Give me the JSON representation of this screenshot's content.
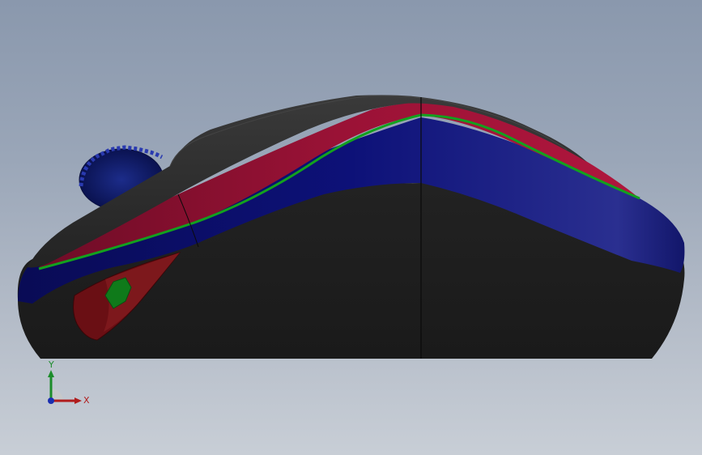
{
  "viewport": {
    "background_top": "#8a98ad",
    "background_bottom": "#c8ced6"
  },
  "model": {
    "colors": {
      "body_shell": "#1f1f1f",
      "top_shell": "#2e2e2e",
      "stripe_red": "#8c1030",
      "stripe_blue": "#0c0f6e",
      "accent_green": "#13a11e",
      "wheel": "#13206b",
      "side_panel": "#7a1418"
    }
  },
  "triad": {
    "y_label": "Y",
    "x_label": "X",
    "y_color": "#1b8c2a",
    "x_color": "#b01c1c",
    "z_color": "#1a2fb0"
  }
}
